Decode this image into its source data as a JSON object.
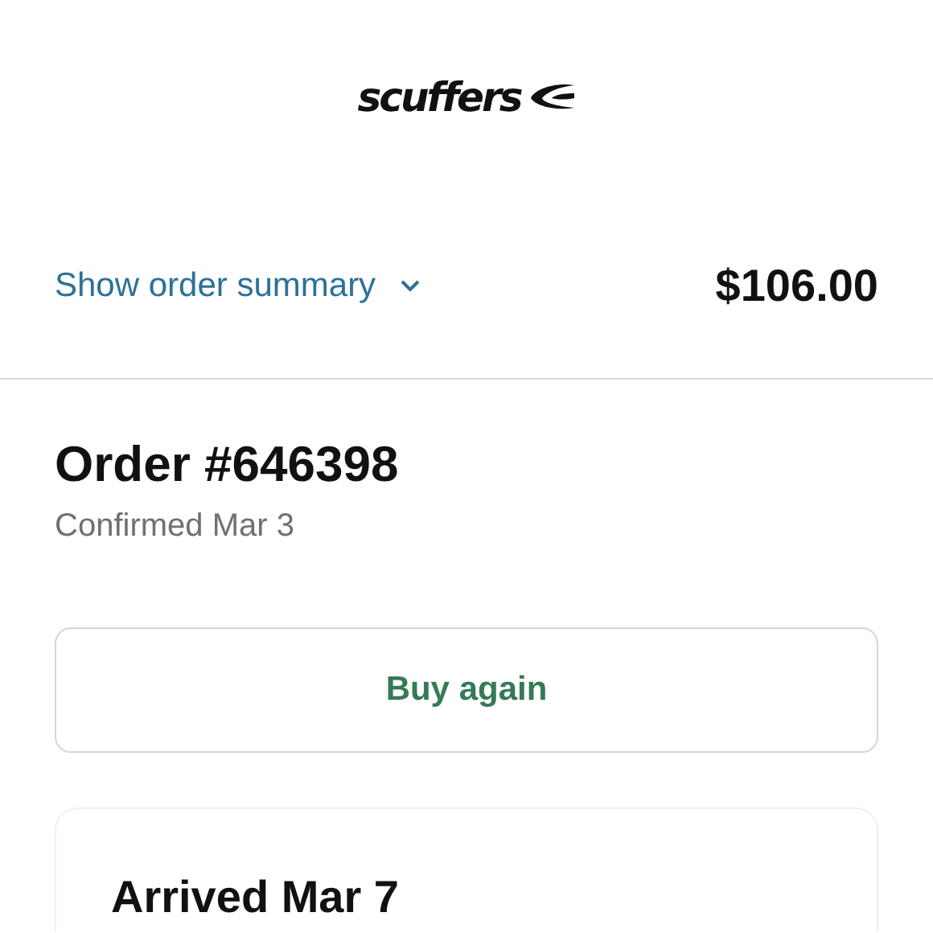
{
  "header": {
    "logo": "scuffers"
  },
  "summary": {
    "label": "Show order summary",
    "expanded": false,
    "total": "$106.00"
  },
  "order": {
    "title": "Order #646398",
    "subtitle": "Confirmed Mar 3"
  },
  "buttons": [
    "Buy again"
  ],
  "status_card": {
    "title": "Arrived Mar 7"
  }
}
